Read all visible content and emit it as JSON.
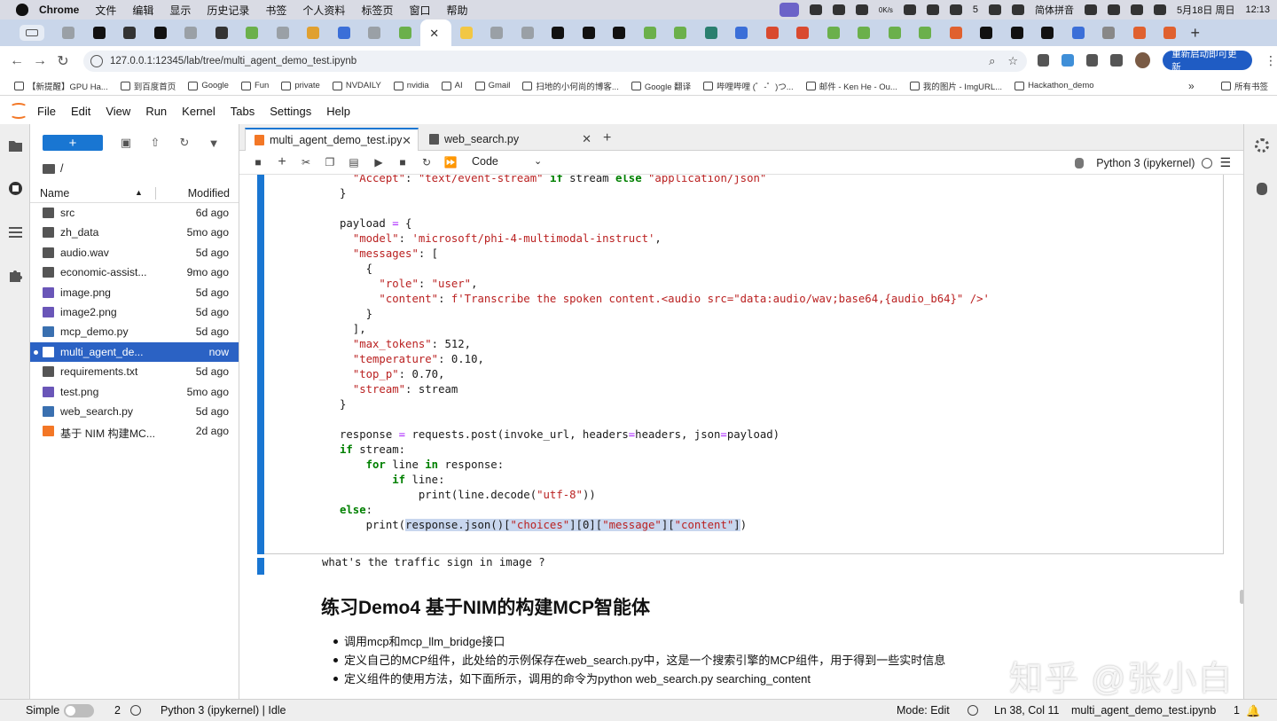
{
  "macos": {
    "app": "Chrome",
    "menus": [
      "文件",
      "编辑",
      "显示",
      "历史记录",
      "书签",
      "个人资料",
      "标签页",
      "窗口",
      "帮助"
    ],
    "status_right": {
      "net": "0K/s",
      "wechat_count": "5",
      "ime": "简体拼音",
      "date": "5月18日 周日",
      "time": "12:13"
    }
  },
  "browser": {
    "url": "127.0.0.1:12345/lab/tree/multi_agent_demo_test.ipynb",
    "relaunch_label": "重新启动即可更新",
    "tab_colors": [
      "#9aa0a6",
      "#111111",
      "#333333",
      "#111111",
      "#9aa0a6",
      "#333333",
      "#6bb04b",
      "#9aa0a6",
      "#e0a030",
      "#3b6fd8",
      "#9aa0a6",
      "#6bb04b",
      "#ffffff",
      "#f2c744",
      "#9aa0a6",
      "#9aa0a6",
      "#111111",
      "#111111",
      "#111111",
      "#6bb04b",
      "#6bb04b",
      "#2a7f6f",
      "#3b6fd8",
      "#d94a2f",
      "#d94a2f",
      "#6bb04b",
      "#6bb04b",
      "#6bb04b",
      "#6bb04b",
      "#e0612f",
      "#111111",
      "#111111",
      "#111111",
      "#3b6fd8",
      "#888888",
      "#e0612f",
      "#e0612f"
    ],
    "bookmarks": [
      {
        "label": "【新提醒】GPU Ha...",
        "icon": "site-icon"
      },
      {
        "label": "到百度首页",
        "icon": "baidu-icon"
      },
      {
        "label": "Google",
        "icon": "google-icon"
      },
      {
        "label": "Fun",
        "icon": "folder-icon"
      },
      {
        "label": "private",
        "icon": "folder-icon"
      },
      {
        "label": "NVDAILY",
        "icon": "folder-icon"
      },
      {
        "label": "nvidia",
        "icon": "folder-icon"
      },
      {
        "label": "AI",
        "icon": "folder-icon"
      },
      {
        "label": "Gmail",
        "icon": "gmail-icon"
      },
      {
        "label": "扫地的小何尚的博客...",
        "icon": "csdn-icon"
      },
      {
        "label": "Google 翻译",
        "icon": "translate-icon"
      },
      {
        "label": "哔哩哔哩 (゜-゜)つ...",
        "icon": "bilibili-icon"
      },
      {
        "label": "邮件 - Ken He - Ou...",
        "icon": "mail-icon"
      },
      {
        "label": "我的图片 - ImgURL...",
        "icon": "image-icon"
      },
      {
        "label": "Hackathon_demo",
        "icon": "folder-icon"
      }
    ],
    "bookmarks_more": "»",
    "all_bookmarks": "所有书签"
  },
  "jupyter": {
    "menu": [
      "File",
      "Edit",
      "View",
      "Run",
      "Kernel",
      "Tabs",
      "Settings",
      "Help"
    ],
    "filebrowser": {
      "path": "/",
      "col_name": "Name",
      "col_modified": "Modified",
      "files": [
        {
          "name": "src",
          "modified": "6d ago",
          "type": "folder"
        },
        {
          "name": "zh_data",
          "modified": "5mo ago",
          "type": "folder"
        },
        {
          "name": "audio.wav",
          "modified": "5d ago",
          "type": "file"
        },
        {
          "name": "economic-assist...",
          "modified": "9mo ago",
          "type": "folder"
        },
        {
          "name": "image.png",
          "modified": "5d ago",
          "type": "image"
        },
        {
          "name": "image2.png",
          "modified": "5d ago",
          "type": "image"
        },
        {
          "name": "mcp_demo.py",
          "modified": "5d ago",
          "type": "python"
        },
        {
          "name": "multi_agent_de...",
          "modified": "now",
          "type": "notebook",
          "selected": true
        },
        {
          "name": "requirements.txt",
          "modified": "5d ago",
          "type": "file"
        },
        {
          "name": "test.png",
          "modified": "5mo ago",
          "type": "image"
        },
        {
          "name": "web_search.py",
          "modified": "5d ago",
          "type": "python"
        },
        {
          "name": "基于 NIM 构建MC...",
          "modified": "2d ago",
          "type": "notebook"
        }
      ]
    },
    "tabs": [
      {
        "label": "multi_agent_demo_test.ipy",
        "active": true
      },
      {
        "label": "web_search.py",
        "active": false
      }
    ],
    "toolbar": {
      "cell_type": "Code",
      "kernel": "Python 3 (ipykernel)"
    },
    "code_lines": [
      "  \"Accept\": \"text/event-stream\" if stream else \"application/json\"",
      "}",
      "",
      "payload = {",
      "  \"model\": 'microsoft/phi-4-multimodal-instruct',",
      "  \"messages\": [",
      "    {",
      "      \"role\": \"user\",",
      "      \"content\": f'Transcribe the spoken content.<audio src=\"data:audio/wav;base64,{audio_b64}\" />'",
      "    }",
      "  ],",
      "  \"max_tokens\": 512,",
      "  \"temperature\": 0.10,",
      "  \"top_p\": 0.70,",
      "  \"stream\": stream",
      "}",
      "",
      "response = requests.post(invoke_url, headers=headers, json=payload)",
      "if stream:",
      "    for line in response:",
      "        if line:",
      "            print(line.decode(\"utf-8\"))",
      "else:",
      "    print(response.json()[\"choices\"][0][\"message\"][\"content\"])"
    ],
    "markdown_cell": "what's the traffic sign in image ?",
    "heading": "练习Demo4 基于NIM的构建MCP智能体",
    "bullets": [
      "调用mcp和mcp_llm_bridge接口",
      "定义自己的MCP组件，此处给的示例保存在web_search.py中，这是一个搜索引擎的MCP组件，用于得到一些实时信息",
      "定义组件的使用方法，如下面所示，调用的命令为python web_search.py searching_content"
    ],
    "watermark": "知乎 @张小白",
    "status": {
      "mode_label": "Simple",
      "count": "2",
      "kernel": "Python 3 (ipykernel) | Idle",
      "edit_mode": "Mode: Edit",
      "cursor": "Ln 38, Col 11",
      "file": "multi_agent_demo_test.ipynb",
      "notifications": "1"
    }
  }
}
